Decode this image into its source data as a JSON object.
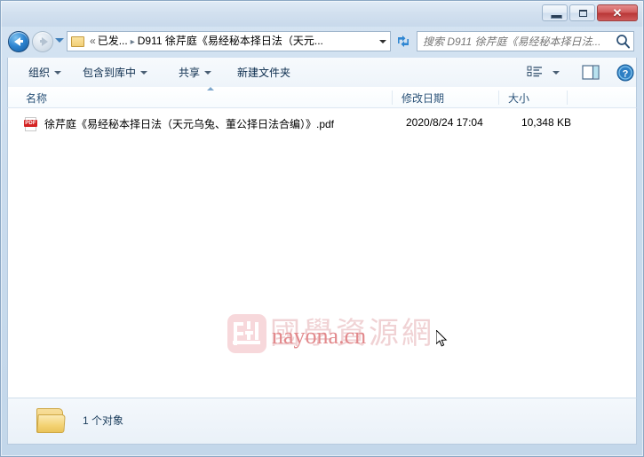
{
  "window": {
    "controls": {
      "minimize_label": "–",
      "maximize_label": "□",
      "close_label": "✕"
    }
  },
  "navbar": {
    "back_tooltip": "后退",
    "forward_tooltip": "前进",
    "address": {
      "chevron": "«",
      "crumb1": "已发...",
      "separator": "▸",
      "crumb2": "D911 徐芹庭《易经秘本择日法（天元...",
      "folder_icon": "folder-icon",
      "dropdown_icon": "chevron-down-icon"
    },
    "refresh_icon": "refresh-icon",
    "search": {
      "placeholder": "搜索 D911 徐芹庭《易经秘本择日法...",
      "value": "",
      "icon": "search-icon"
    }
  },
  "toolbar": {
    "organize_label": "组织",
    "include_in_library_label": "包含到库中",
    "share_label": "共享",
    "new_folder_label": "新建文件夹",
    "view_icon": "list-view-icon",
    "view_caret_icon": "chevron-down-icon",
    "preview_pane_icon": "preview-pane-icon",
    "help_icon": "help-icon",
    "help_label": "?"
  },
  "columns": {
    "name": "名称",
    "date_modified": "修改日期",
    "size": "大小",
    "sort_icon": "sort-ascending-icon"
  },
  "files": [
    {
      "icon": "pdf-file-icon",
      "icon_label": "PDF",
      "name": "徐芹庭《易经秘本择日法（天元乌兔、董公择日法合编）》.pdf",
      "date_modified": "2020/8/24 17:04",
      "size": "10,348 KB"
    }
  ],
  "watermark": {
    "cjk_text": "國學資源網",
    "latin_text": "nayona.cn",
    "logo_icon": "site-logo-icon"
  },
  "statusbar": {
    "folder_icon": "folder-icon",
    "item_count_text": "1 个对象"
  },
  "colors": {
    "frame": "#c3d7ea",
    "accent_blue": "#2f86d2",
    "close_red": "#b83636",
    "pdf_red": "#d42323",
    "watermark_pink": "#e2898c",
    "folder_yellow": "#f3d273"
  }
}
